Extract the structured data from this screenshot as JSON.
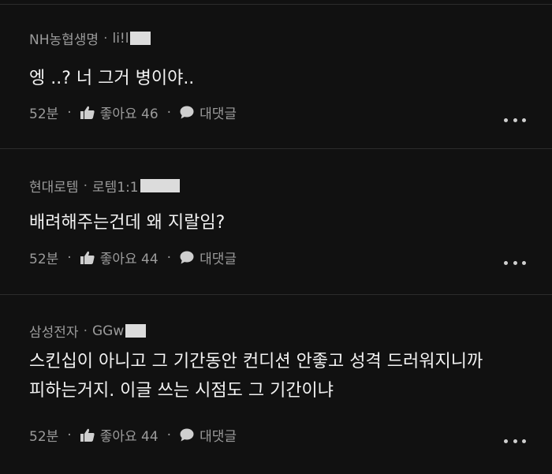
{
  "comments": [
    {
      "author": "NH농협생명",
      "user_id": "li!l",
      "text_lines": [
        "엥 ..? 너 그거 병이야.."
      ],
      "time": "52분",
      "like_label": "좋아요 46",
      "reply_label": "대댓글"
    },
    {
      "author": "현대로템",
      "user_id": "로템1:1",
      "text_lines": [
        "배려해주는건데 왜 지랄임?"
      ],
      "time": "52분",
      "like_label": "좋아요 44",
      "reply_label": "대댓글"
    },
    {
      "author": "삼성전자",
      "user_id": "GGw",
      "text_lines": [
        "스킨십이 아니고 그 기간동안 컨디션 안좋고 성격 드러워지니까",
        "피하는거지. 이글 쓰는 시점도 그 기간이냐"
      ],
      "time": "52분",
      "like_label": "좋아요 44",
      "reply_label": "대댓글"
    }
  ],
  "separator": "·",
  "icons": {
    "like": "thumbs-up-icon",
    "reply": "speech-bubble-icon",
    "more": "more-options-icon"
  }
}
